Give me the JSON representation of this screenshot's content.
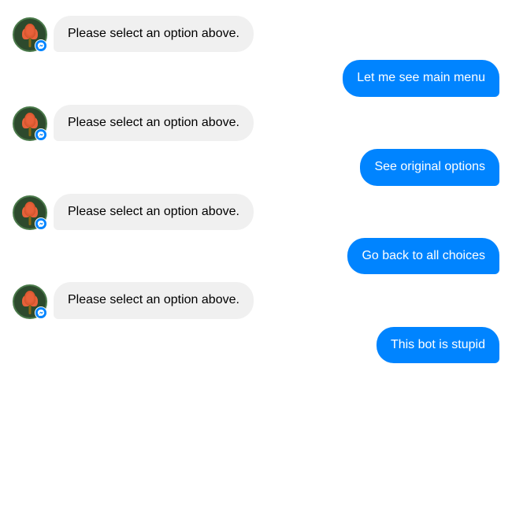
{
  "messages": [
    {
      "id": 1,
      "type": "bot",
      "text": "Please select an option above."
    },
    {
      "id": 2,
      "type": "user",
      "text": "Let me see main menu"
    },
    {
      "id": 3,
      "type": "bot",
      "text": "Please select an option above."
    },
    {
      "id": 4,
      "type": "user",
      "text": "See original options"
    },
    {
      "id": 5,
      "type": "bot",
      "text": "Please select an option above."
    },
    {
      "id": 6,
      "type": "user",
      "text": "Go back to all choices"
    },
    {
      "id": 7,
      "type": "bot",
      "text": "Please select an option above."
    },
    {
      "id": 8,
      "type": "user",
      "text": "This bot is stupid"
    }
  ],
  "bot_select_label": "Please select an option above.",
  "user_messages": {
    "msg1": "Let me see main menu",
    "msg2": "See original options",
    "msg3": "Go back to all choices",
    "msg4": "This bot is stupid"
  },
  "messenger_icon_title": "Messenger"
}
